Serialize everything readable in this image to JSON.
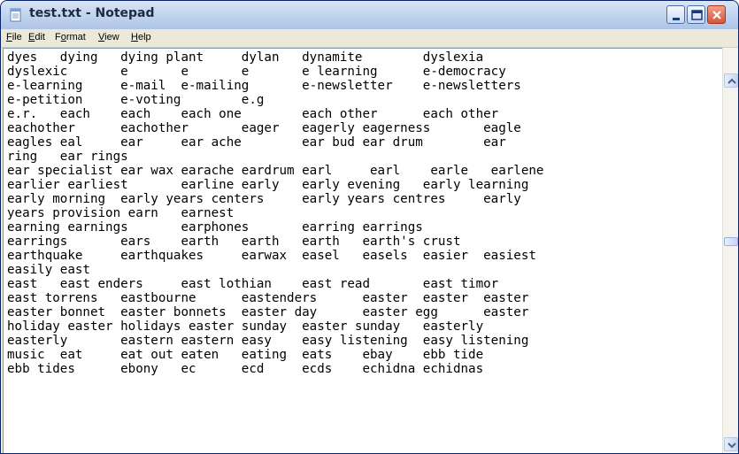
{
  "window": {
    "title": "test.txt - Notepad",
    "icon": "notepad-icon",
    "controls": [
      "minimize-icon",
      "maximize-icon",
      "close-icon"
    ]
  },
  "menu": [
    {
      "label": "File",
      "accel": "F",
      "rest": "ile"
    },
    {
      "label": "Edit",
      "accel": "E",
      "rest": "dit"
    },
    {
      "label": "Format",
      "pre": "F",
      "accel": "o",
      "rest": "rmat"
    },
    {
      "label": "View",
      "accel": "V",
      "rest": "iew"
    },
    {
      "label": "Help",
      "accel": "H",
      "rest": "elp"
    }
  ],
  "document": {
    "lines": [
      "dyes   dying   dying plant     dylan   dynamite        dyslexia",
      "dyslexic       e       e       e       e learning      e-democracy",
      "e-learning     e-mail  e-mailing       e-newsletter    e-newsletters",
      "e-petition     e-voting        e.g",
      "e.r.   each    each    each one        each other      each other",
      "eachother      eachother       eager   eagerly eagerness       eagle",
      "eagles eal     ear     ear ache        ear bud ear drum        ear",
      "ring   ear rings",
      "ear specialist ear wax earache eardrum earl     earl    earle   earlene",
      "earlier earliest       earline early   early evening   early learning",
      "early morning  early years centers     early years centres     early",
      "years provision earn   earnest",
      "earning earnings       earphones       earring earrings",
      "earrings       ears    earth   earth   earth   earth's crust",
      "earthquake     earthquakes     earwax  easel   easels  easier  easiest",
      "easily east",
      "east   east enders     east lothian    east read       east timor",
      "east torrens   eastbourne      eastenders      easter  easter  easter",
      "easter bonnet  easter bonnets  easter day      easter egg      easter",
      "holiday easter holidays easter sunday  easter sunday   easterly",
      "easterly       eastern eastern easy    easy listening  easy listening",
      "music  eat     eat out eaten   eating  eats    ebay    ebb tide",
      "ebb tides      ebony   ec      ecd     ecds    echidna echidnas"
    ]
  },
  "scrollbar": {
    "up_icon": "scroll-up-arrow-icon",
    "down_icon": "scroll-down-arrow-icon",
    "position_fraction": 0.45
  },
  "colors": {
    "title_text": "#1b2a45",
    "close_button": "#d6553a",
    "menu_bg": "#ece9d8",
    "editor_bg": "#ffffff"
  }
}
